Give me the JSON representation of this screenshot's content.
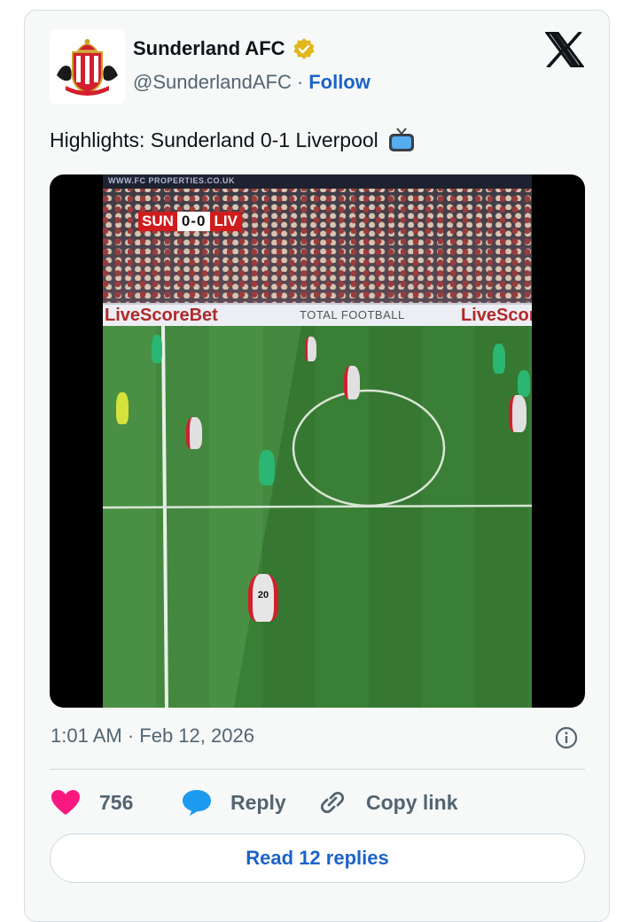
{
  "account": {
    "name": "Sunderland AFC",
    "handle": "@SunderlandAFC",
    "separator": "·",
    "follow_label": "Follow"
  },
  "tweet": {
    "text": "Highlights: Sunderland 0-1 Liverpool"
  },
  "video": {
    "score_home": "SUN",
    "score_value": "0-0",
    "score_away": "LIV",
    "board_left": "LiveScoreBet",
    "board_center": "TOTAL FOOTBALL",
    "board_right": "LiveScor",
    "player_number": "20"
  },
  "meta": {
    "timestamp": "1:01 AM · Feb 12, 2026"
  },
  "actions": {
    "likes_count": "756",
    "reply_label": "Reply",
    "copy_link_label": "Copy link"
  },
  "read_replies_label": "Read 12 replies",
  "colors": {
    "accent": "#1d63c7",
    "like": "#f91880",
    "reply_icon": "#1d9bf0",
    "verified": "#e2b719",
    "text_secondary": "#536471"
  }
}
